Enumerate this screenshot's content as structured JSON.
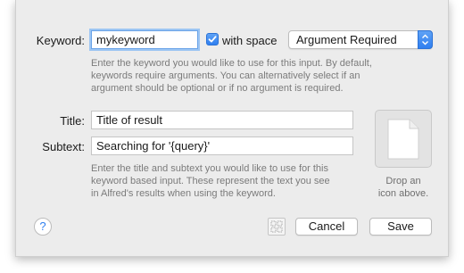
{
  "keyword": {
    "label": "Keyword:",
    "value": "mykeyword",
    "with_space_checked": true,
    "with_space_label": "with space",
    "argument_select": "Argument Required",
    "help": [
      "Enter the keyword you would like to use for this input. By default,",
      "keywords require arguments. You can alternatively select if an",
      "argument should be optional or if no argument is required."
    ]
  },
  "title": {
    "label": "Title:",
    "value": "Title of result"
  },
  "subtext": {
    "label": "Subtext:",
    "value": "Searching for '{query}'",
    "help": [
      "Enter the title and subtext you would like to use for this",
      "keyword based input. These represent the text you see",
      "in Alfred's results when using the keyword."
    ]
  },
  "icon_drop": {
    "line1": "Drop an",
    "line2": "icon above.",
    "icon": "blank-document-icon"
  },
  "footer": {
    "help_label": "?",
    "cancel_label": "Cancel",
    "save_label": "Save",
    "grid_icon": "grid-icon"
  },
  "colors": {
    "accent": "#2f7ff0",
    "sheet_bg": "#ececec",
    "help_text": "#7b7b7b"
  }
}
